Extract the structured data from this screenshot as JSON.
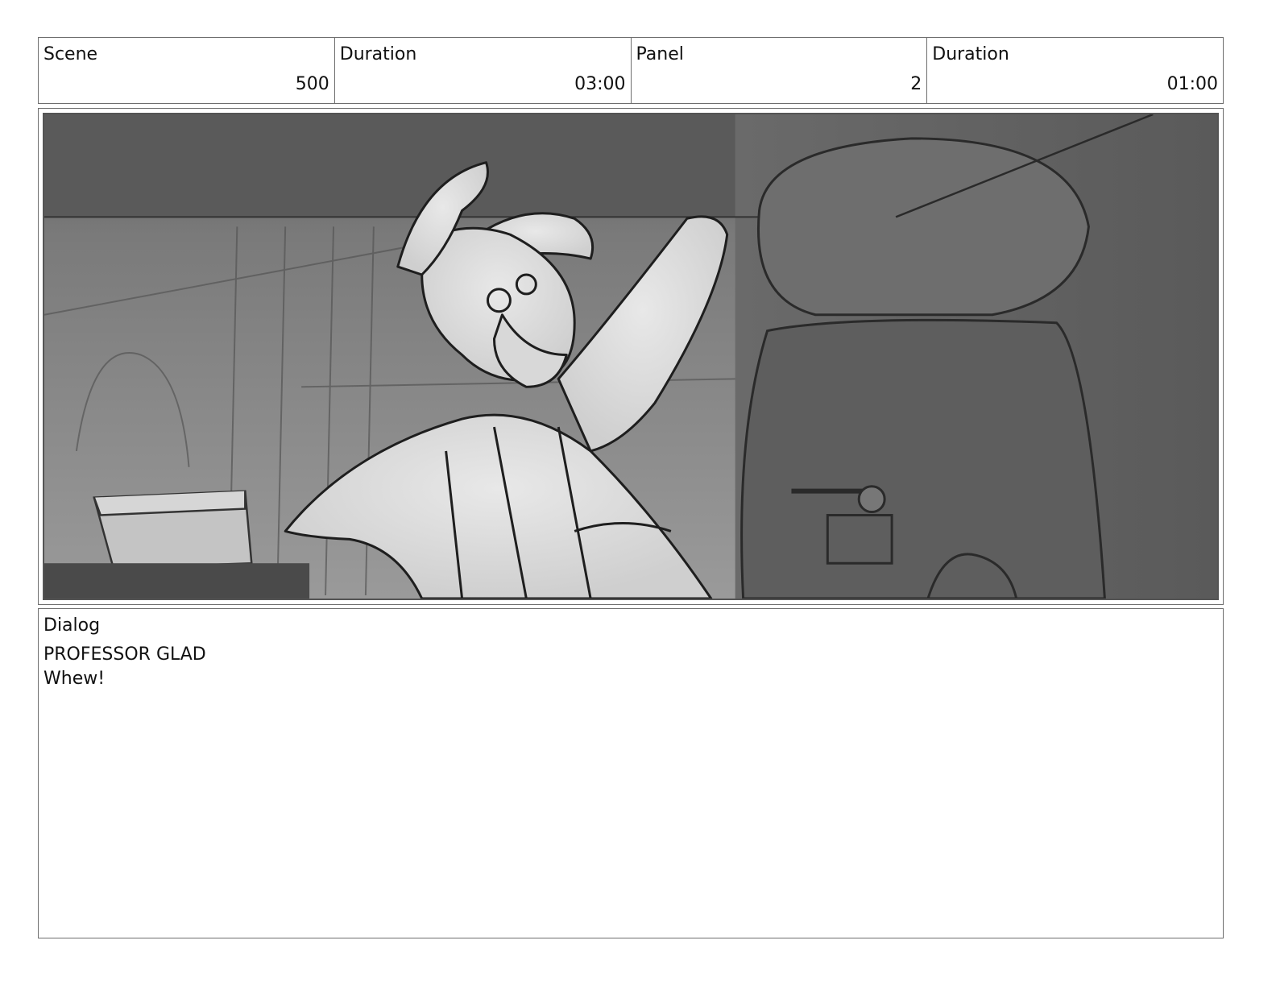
{
  "header": {
    "scene_label": "Scene",
    "scene_value": "500",
    "scene_duration_label": "Duration",
    "scene_duration_value": "03:00",
    "panel_label": "Panel",
    "panel_value": "2",
    "panel_duration_label": "Duration",
    "panel_duration_value": "01:00"
  },
  "panel": {
    "image_icon": "storyboard-sketch"
  },
  "dialog": {
    "label": "Dialog",
    "character": "PROFESSOR GLAD",
    "line": "Whew!"
  }
}
